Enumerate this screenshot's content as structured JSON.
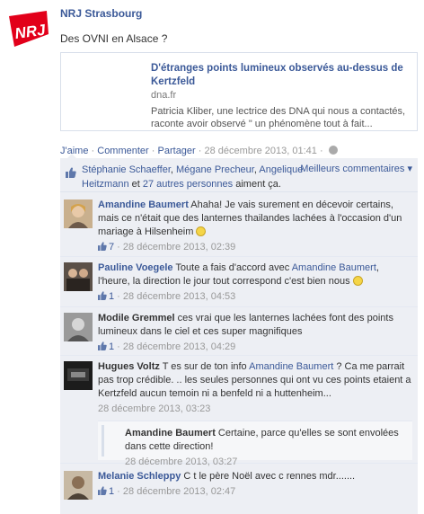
{
  "page": {
    "name": "NRJ Strasbourg",
    "logo_text": "NRJ",
    "post_text": "Des OVNI en Alsace ?"
  },
  "preview": {
    "title": "D'étranges points lumineux observés au-dessus de Kertzfeld",
    "domain": "dna.fr",
    "description": "Patricia Kliber, une lectrice des DNA qui nous a contactés, raconte avoir observé \" un phénomène tout à fait..."
  },
  "actions": {
    "like": "J'aime",
    "comment": "Commenter",
    "share": "Partager",
    "sep": "·",
    "timestamp": "28 décembre 2013, 01:41",
    "dot": "·"
  },
  "likes": {
    "name1": "Stéphanie Schaeffer",
    "comma1": ", ",
    "name2": "Mégane Precheur",
    "comma2": ", ",
    "name3": "Angelique Heitzmann",
    "and": " et ",
    "others": "27 autres personnes",
    "suffix": " aiment ça.",
    "best_comments": "Meilleurs commentaires ▾"
  },
  "comments": [
    {
      "author": "Amandine Baumert",
      "text": " Ahaha! Je vais surement en décevoir certains, mais ce n'était que des lanternes thailandes lachées à l'occasion d'un mariage à Hilsenheim ",
      "likes": "7",
      "timestamp": "28 décembre 2013, 02:39"
    },
    {
      "author": "Pauline Voegele",
      "text_before": " Toute a fais d'accord avec ",
      "mention": "Amandine Baumert",
      "text_after": ", l'heure, la direction le jour tout correspond c'est bien nous ",
      "likes": "1",
      "timestamp": "28 décembre 2013, 04:53"
    },
    {
      "author": "Modile Gremmel",
      "text": " ces vrai que les lanternes lachées font des points lumineux dans le ciel et ces super magnifiques",
      "likes": "1",
      "timestamp": "28 décembre 2013, 04:29"
    },
    {
      "author": "Hugues Voltz",
      "text_before": " T es sur de ton info ",
      "mention": "Amandine Baumert",
      "text_after": " ? Ca me parrait pas trop crédible. .. les seules personnes qui ont vu ces points etaient a Kertzfeld aucun temoin ni a benfeld ni a huttenheim...",
      "timestamp": "28 décembre 2013, 03:23",
      "reply": {
        "author": "Amandine Baumert",
        "text": " Certaine, parce qu'elles se sont envolées dans cette direction!",
        "timestamp": "28 décembre 2013, 03:27"
      }
    },
    {
      "author": "Melanie Schleppy",
      "text": " C t le père Noël avec c rennes mdr.......",
      "likes": "1",
      "timestamp": "28 décembre 2013, 02:47"
    }
  ],
  "colors": {
    "link": "#3b5998",
    "brand": "#e2001a",
    "ufi_bg": "#edeff4"
  }
}
